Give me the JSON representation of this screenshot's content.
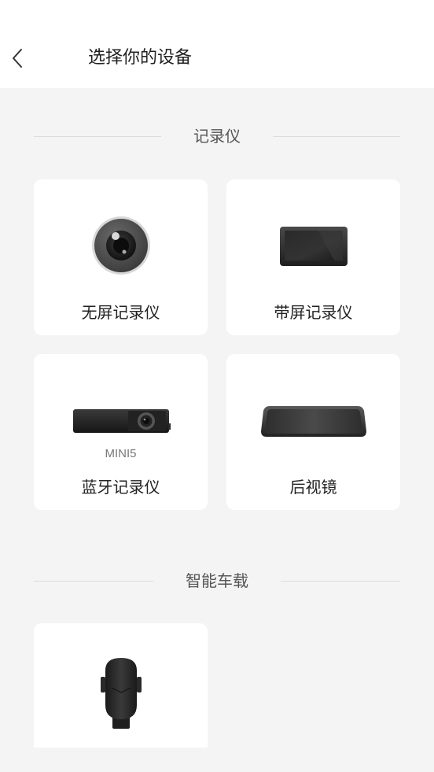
{
  "header": {
    "title": "选择你的设备",
    "back_icon": "chevron-left-icon"
  },
  "sections": [
    {
      "title": "记录仪",
      "devices": [
        {
          "label": "无屏记录仪",
          "icon": "dashcam-lens-icon"
        },
        {
          "label": "带屏记录仪",
          "icon": "dashcam-screen-icon"
        },
        {
          "label": "蓝牙记录仪",
          "sublabel": "MINI5",
          "icon": "bluetooth-dashcam-icon"
        },
        {
          "label": "后视镜",
          "icon": "rearview-mirror-icon"
        }
      ]
    },
    {
      "title": "智能车载",
      "devices": [
        {
          "label": "",
          "icon": "car-phone-holder-icon"
        }
      ]
    }
  ],
  "colors": {
    "background": "#f4f4f4",
    "card": "#ffffff",
    "text": "#222222",
    "section_title": "#555555",
    "divider": "#dcdcdc"
  }
}
